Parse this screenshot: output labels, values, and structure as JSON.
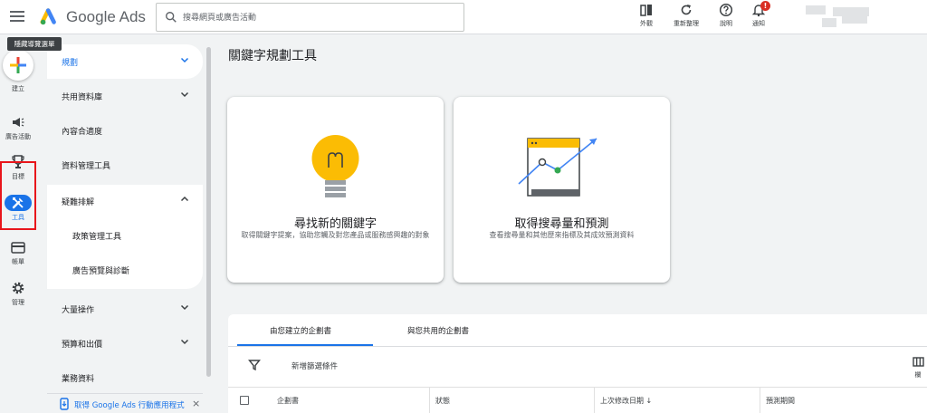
{
  "topbar": {
    "menu_tooltip": "隱藏導覽選單",
    "brand": "Google Ads",
    "search_placeholder": "搜尋網頁或廣告活動",
    "actions": [
      {
        "icon": "appearance-icon",
        "label": "外觀"
      },
      {
        "icon": "refresh-icon",
        "label": "重新整理"
      },
      {
        "icon": "help-icon",
        "label": "說明"
      },
      {
        "icon": "bell-icon",
        "label": "通知",
        "badge": "!"
      }
    ]
  },
  "rail": {
    "items": [
      {
        "icon": "create-plus-icon",
        "label": "建立"
      },
      {
        "icon": "campaign-icon",
        "label": "廣告活動"
      },
      {
        "icon": "trophy-icon",
        "label": "目標"
      },
      {
        "icon": "tools-icon",
        "label": "工具",
        "active": true
      },
      {
        "icon": "billing-icon",
        "label": "帳單"
      },
      {
        "icon": "gear-icon",
        "label": "管理"
      }
    ]
  },
  "sidenav": {
    "items": [
      {
        "label": "規劃",
        "selected": true,
        "expandable": true
      },
      {
        "label": "共用資料庫",
        "expandable": true
      },
      {
        "label": "內容合適度"
      },
      {
        "label": "資料管理工具"
      },
      {
        "label": "疑難排解",
        "expanded": true
      }
    ],
    "sub_items": [
      "政策管理工具",
      "廣告預覽與診斷"
    ],
    "items_after": [
      {
        "label": "大量操作",
        "expandable": true
      },
      {
        "label": "預算和出價",
        "expandable": true
      },
      {
        "label": "業務資料"
      }
    ],
    "app_promo": "取得 Google Ads 行動應用程式",
    "close": "×"
  },
  "main": {
    "title": "關鍵字規劃工具",
    "cards": [
      {
        "title": "尋找新的關鍵字",
        "desc": "取得關鍵字提案，協助您觸及對您產品或服務感興趣的對象",
        "icon": "lightbulb-icon"
      },
      {
        "title": "取得搜尋量和預測",
        "desc": "查看搜尋量和其他歷來指標及其成效預測資料",
        "icon": "forecast-chart-icon"
      }
    ],
    "tabs": [
      "由您建立的企劃書",
      "與您共用的企劃書"
    ],
    "filter_label": "新增篩選條件",
    "columns_label": "欄",
    "table_headers": [
      "企劃書",
      "狀態",
      "上次修改日期 ↓",
      "預測期間"
    ]
  },
  "colors": {
    "accent": "#1a73e8",
    "highlight_box": "#e8151b",
    "background": "#f1f3f4"
  }
}
